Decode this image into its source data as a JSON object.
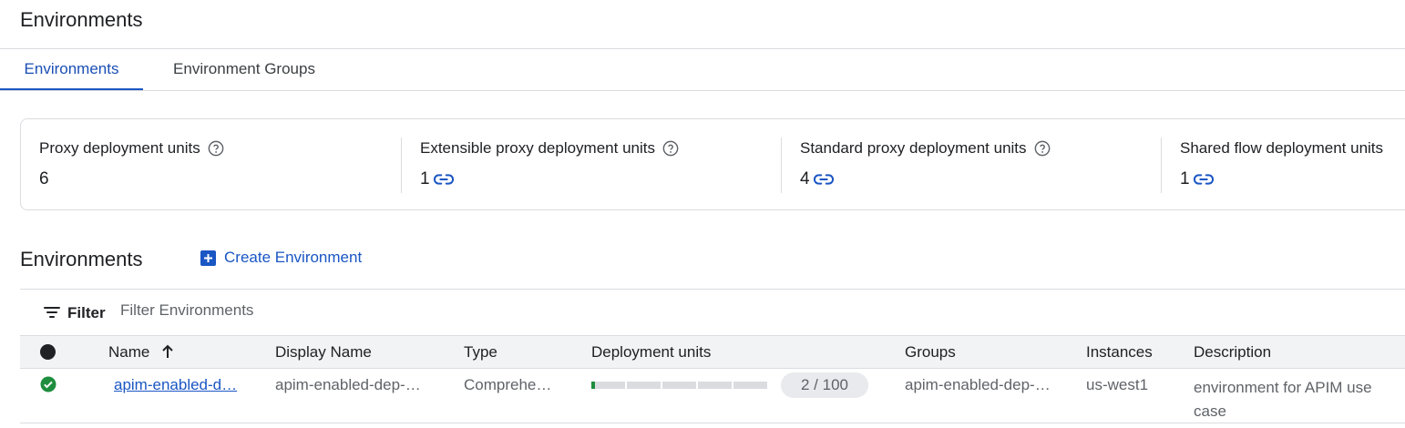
{
  "page": {
    "title": "Environments"
  },
  "tabs": [
    {
      "label": "Environments",
      "active": true
    },
    {
      "label": "Environment Groups",
      "active": false
    }
  ],
  "summary": {
    "metrics": [
      {
        "label": "Proxy deployment units",
        "value": "6",
        "has_help": true,
        "has_link": false
      },
      {
        "label": "Extensible proxy deployment units",
        "value": "1",
        "has_help": true,
        "has_link": true
      },
      {
        "label": "Standard proxy deployment units",
        "value": "4",
        "has_help": true,
        "has_link": true
      },
      {
        "label": "Shared flow deployment units",
        "value": "1",
        "has_help": false,
        "has_link": true
      }
    ]
  },
  "section": {
    "title": "Environments",
    "create_label": "Create Environment"
  },
  "filter": {
    "label": "Filter",
    "placeholder": "Filter Environments"
  },
  "table": {
    "columns": {
      "name": "Name",
      "display_name": "Display Name",
      "type": "Type",
      "deployment_units": "Deployment units",
      "groups": "Groups",
      "instances": "Instances",
      "description": "Description"
    },
    "rows": [
      {
        "status": "ok",
        "name": "apim-enabled-d…",
        "display_name": "apim-enabled-dep-…",
        "type": "Comprehe…",
        "deployment_units": "2 / 100",
        "deployment_fraction": 0.02,
        "groups": "apim-enabled-dep-…",
        "instances": "us-west1",
        "description": "environment for APIM use case"
      }
    ]
  },
  "colors": {
    "accent": "#1a56c4",
    "success": "#1e8e3e",
    "progress_track": "#dadce0"
  }
}
